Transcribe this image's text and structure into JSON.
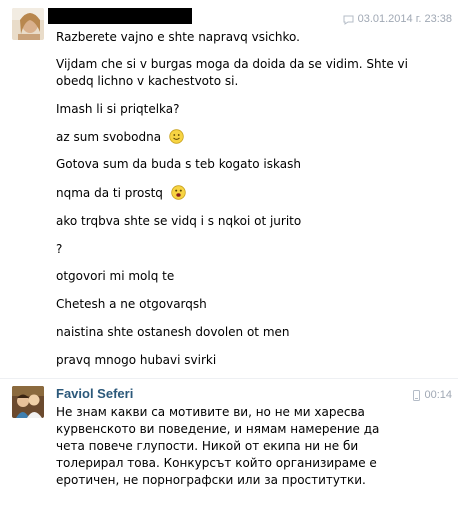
{
  "messages": [
    {
      "sender": "",
      "meta": {
        "date": "03.01.2014 г. 23:38",
        "icon": "chat-bubble-icon"
      },
      "lines": [
        "Razberete vajno e shte napravq vsichko.",
        "Vijdam che si v burgas moga da doida da se vidim. Shte vi",
        "obedq lichno v kachestvoto si.",
        "Imash li si priqtelka?",
        "az sum svobodna",
        "Gotova sum da buda s teb kogato iskash",
        "nqma da ti prostq",
        "ako trqbva shte se vidq i s nqkoi ot jurito",
        "?",
        "otgovori mi molq te",
        "Chetesh a ne otgovarqsh",
        "naistina shte ostanesh dovolen ot men",
        "pravq mnogo hubavi svirki"
      ],
      "emojis": {
        "line_4": "smile-emoji-icon",
        "line_6": "surprised-emoji-icon"
      }
    },
    {
      "sender": "Faviol Seferi",
      "meta": {
        "time": "00:14",
        "icon": "mobile-phone-icon"
      },
      "text": "Не знам какви са мотивите ви, но не ми харесва курвенското ви поведение, и нямам намерение да чета повече глупости. Никой от екипа ни не би толерирал това. Конкурсът който организираме е еротичен, не порнографски или за проститутки."
    }
  ],
  "colors": {
    "link": "#2b587a",
    "meta": "#a0a8b4",
    "text": "#000000"
  }
}
